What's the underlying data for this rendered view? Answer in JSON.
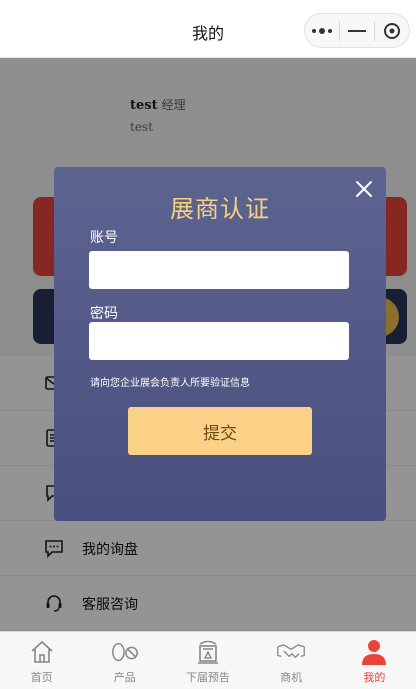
{
  "header": {
    "title": "我的"
  },
  "profile": {
    "name": "test",
    "role": "经理",
    "subtitle": "test"
  },
  "menu": [
    {
      "label": "",
      "icon": "mail-icon"
    },
    {
      "label": "",
      "icon": "document-icon"
    },
    {
      "label": "",
      "icon": "chat-icon"
    },
    {
      "label": "我的询盘",
      "icon": "message-dots-icon"
    },
    {
      "label": "客服咨询",
      "icon": "headset-icon"
    }
  ],
  "modal": {
    "title": "展商认证",
    "account_label": "账号",
    "account_value": "",
    "password_label": "密码",
    "password_value": "",
    "hint": "请向您企业展会负责人所要验证信息",
    "submit_label": "提交"
  },
  "tabbar": {
    "items": [
      {
        "label": "首页",
        "icon": "home-icon"
      },
      {
        "label": "产品",
        "icon": "product-icon"
      },
      {
        "label": "下届预告",
        "icon": "preview-icon"
      },
      {
        "label": "商机",
        "icon": "handshake-icon"
      },
      {
        "label": "我的",
        "icon": "user-icon",
        "active": true
      }
    ]
  },
  "colors": {
    "accent_red": "#e8443a",
    "modal_title": "#f6d27f",
    "submit_bg": "#fbd087",
    "modal_bg": "#525985"
  }
}
